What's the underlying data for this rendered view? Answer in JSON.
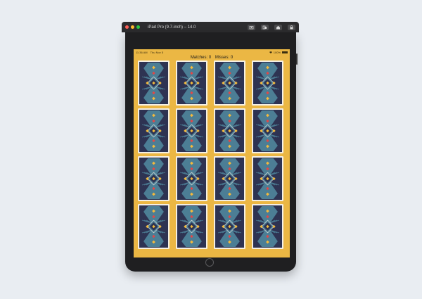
{
  "simulator": {
    "title": "iPad Pro (9.7-inch) – 14.0",
    "toolbar_icons": [
      "screenshot-icon",
      "rotate-icon",
      "home-icon",
      "lock-icon"
    ],
    "window_dots": [
      "#ff5f57",
      "#febc2e",
      "#28c840"
    ]
  },
  "status_bar": {
    "time": "11:36 AM",
    "date": "Thu Nov 5",
    "battery": "100%"
  },
  "game": {
    "matches_label": "Matches: 0",
    "misses_label": "Misses: 0",
    "background_color": "#ebb744",
    "card_count": 16,
    "card_colors": {
      "navy": "#2e3352",
      "teal": "#4c7e95",
      "red": "#e04848",
      "yellow": "#f2b93d",
      "cream": "#f4efe4"
    }
  }
}
